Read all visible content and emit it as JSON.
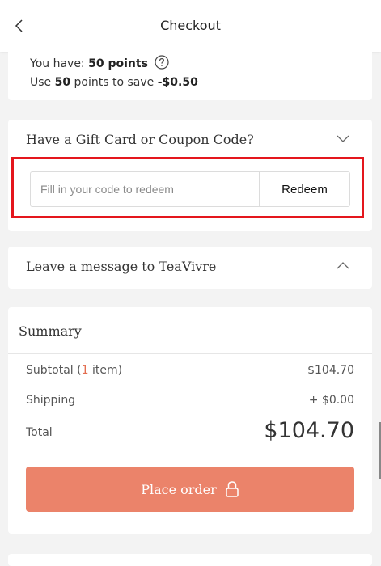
{
  "header": {
    "title": "Checkout",
    "back_icon": "chevron-left-icon"
  },
  "points": {
    "have_prefix": "You have:",
    "have_value": "50 points",
    "use_prefix": "Use",
    "use_value": "50",
    "use_mid": "points to save",
    "save_value": "-$0.50",
    "help_icon": "question-circle-icon"
  },
  "gift_card": {
    "title": "Have a Gift Card or Coupon Code?",
    "expanded_icon": "chevron-down-icon",
    "input_placeholder": "Fill in your code to redeem",
    "input_value": "",
    "redeem_label": "Redeem",
    "highlight_color": "#e4161d"
  },
  "message": {
    "title": "Leave a message to TeaVivre",
    "toggle_icon": "chevron-up-icon"
  },
  "summary": {
    "title": "Summary",
    "subtotal_label_prefix": "Subtotal (",
    "subtotal_count": "1",
    "subtotal_label_suffix": " item)",
    "subtotal_value": "$104.70",
    "shipping_label": "Shipping",
    "shipping_value": "+ $0.00",
    "total_label": "Total",
    "total_value": "$104.70",
    "place_order_label": "Place order",
    "place_order_icon": "lock-icon",
    "accent_color": "#eb836a"
  }
}
